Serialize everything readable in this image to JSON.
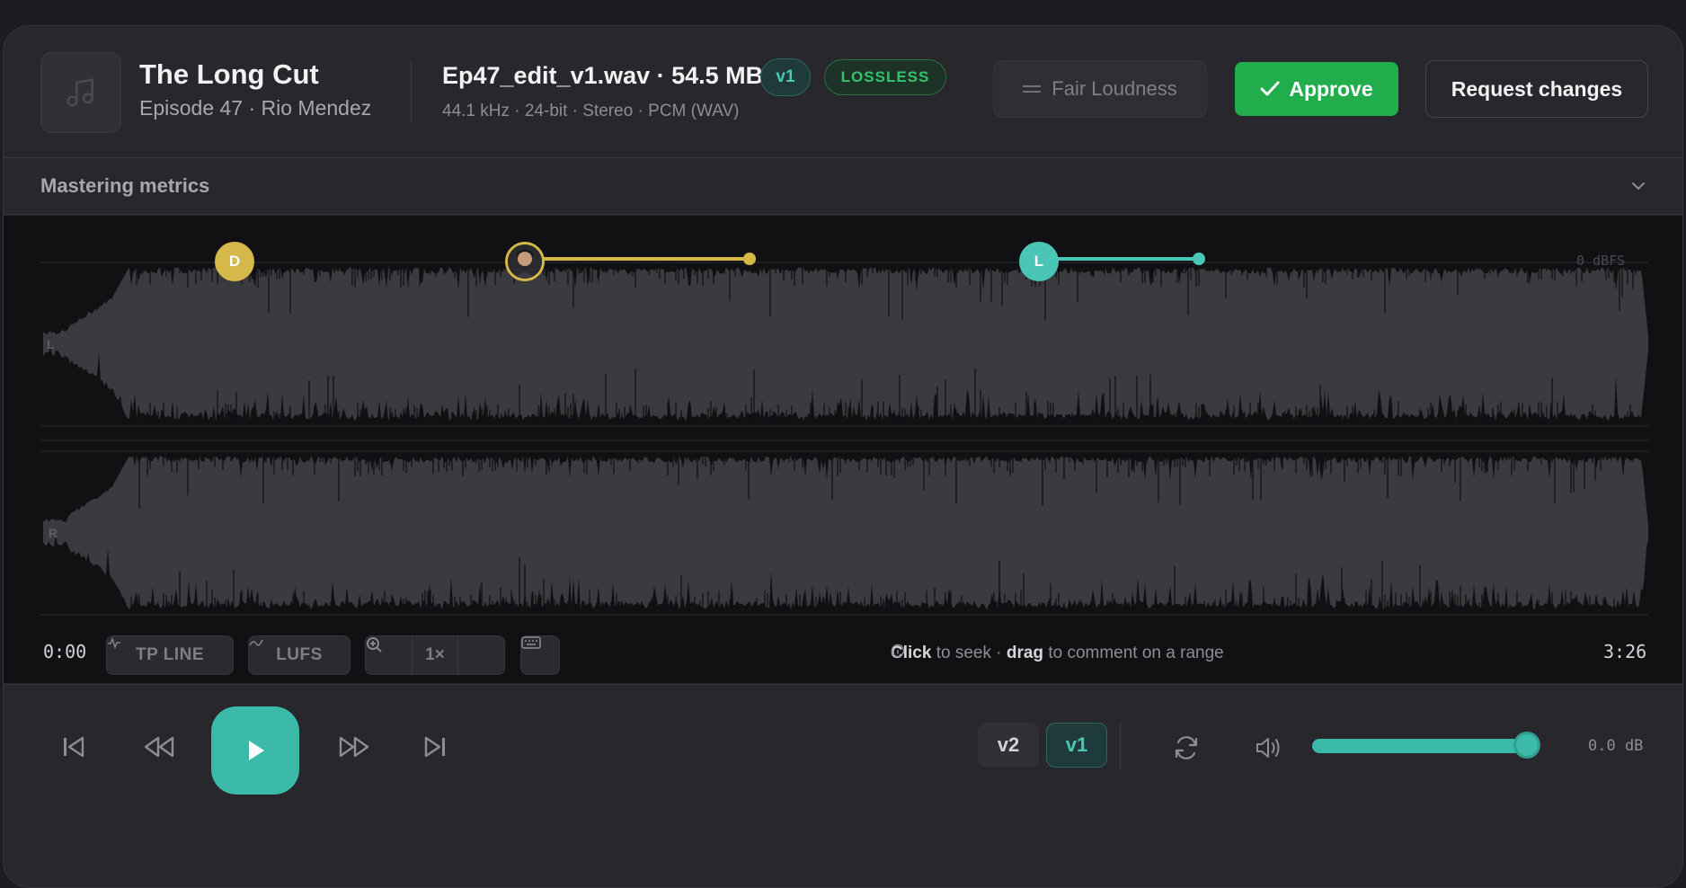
{
  "header": {
    "title": "The Long Cut",
    "subtitle": "Episode 47 · Rio Mendez",
    "filename": "Ep47_edit_v1.wav · 54.5 MB",
    "fileinfo": "44.1 kHz · 24-bit · Stereo · PCM (WAV)",
    "version_badge": "v1",
    "format_badge": "LOSSLESS",
    "fair_loudness_label": "Fair Loudness",
    "approve_label": "Approve",
    "request_changes_label": "Request changes"
  },
  "metrics": {
    "label": "Mastering metrics"
  },
  "waveform": {
    "dbfs_label": "0 dBFS",
    "channels": [
      "L",
      "R"
    ],
    "markers": [
      {
        "label": "D",
        "color": "#d4b84a"
      },
      {
        "label": "",
        "kind": "avatar",
        "color": "#d4b84a"
      },
      {
        "label": "L",
        "color": "#4ac6b6"
      }
    ]
  },
  "toolbar": {
    "current_time": "0:00",
    "tp_line_label": "TP LINE",
    "lufs_label": "LUFS",
    "zoom_label": "1×",
    "hint_click": "Click",
    "hint_seek": "to seek ·",
    "hint_drag": "drag",
    "hint_comment": "to comment on a range",
    "duration": "3:26"
  },
  "transport": {
    "versions": [
      "v2",
      "v1"
    ],
    "active_version": "v1",
    "volume_percent": 100,
    "gain_label": "0.0 dB"
  },
  "colors": {
    "accent": "#3cbaa9",
    "approve": "#22ad4d",
    "marker_gold": "#d4b84a",
    "marker_teal": "#4ac6b6"
  }
}
